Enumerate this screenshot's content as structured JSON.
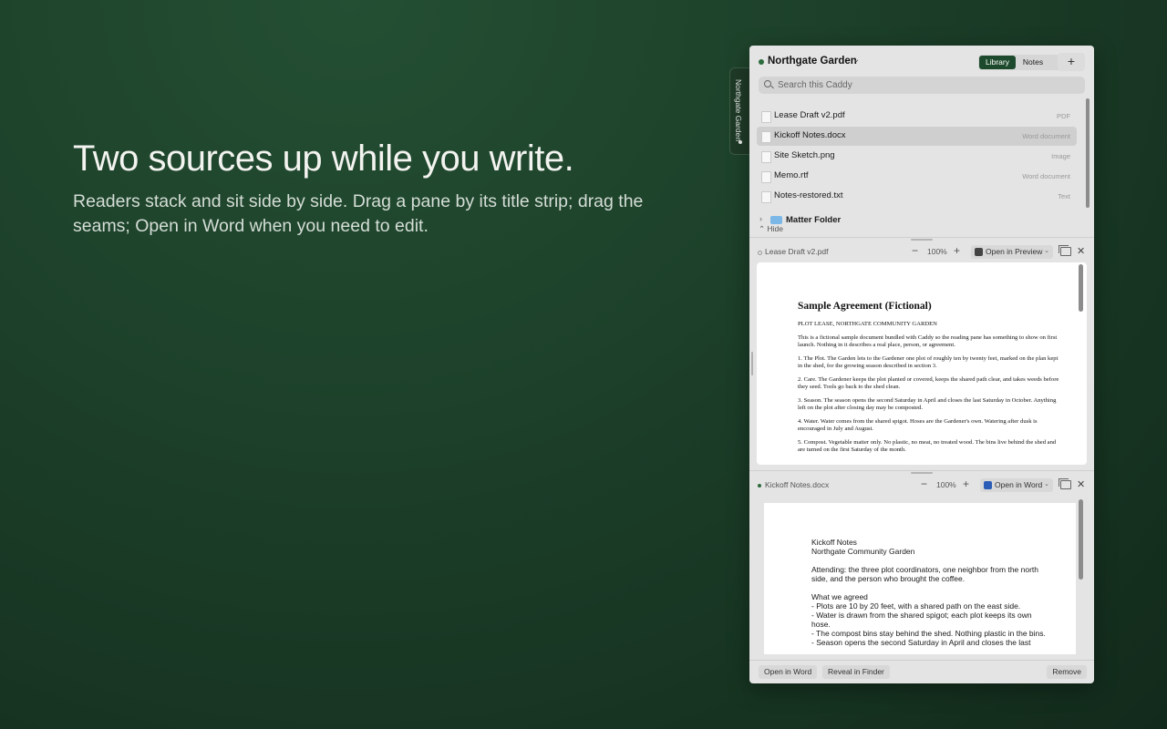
{
  "hero": {
    "headline": "Two sources up while you write.",
    "subline": "Readers stack and sit side by side. Drag a pane by its title strip; drag the seams; Open in Word when you need to edit."
  },
  "side_tab": {
    "label": "Northgate Garden"
  },
  "caddy": {
    "title": "Northgate Garden",
    "segments": {
      "library": "Library",
      "notes": "Notes"
    },
    "add_label": "+",
    "search_placeholder": "Search this Caddy",
    "files": [
      {
        "name": "Lease Draft v2.pdf",
        "type": "PDF"
      },
      {
        "name": "Kickoff Notes.docx",
        "type": "Word document"
      },
      {
        "name": "Site Sketch.png",
        "type": "Image"
      },
      {
        "name": "Memo.rtf",
        "type": "Word document"
      },
      {
        "name": "Notes-restored.txt",
        "type": "Text"
      }
    ],
    "folder": {
      "name": "Matter Folder"
    },
    "hide_label": "Hide"
  },
  "readers": [
    {
      "name": "Lease Draft v2.pdf",
      "zoom": "100%",
      "open_label": "Open in Preview",
      "page_title": "Sample Agreement (Fictional)",
      "lines": [
        "PLOT LEASE, NORTHGATE COMMUNITY GARDEN",
        "This is a fictional sample document bundled with Caddy so the reading pane has something to show on first launch. Nothing in it describes a real place, person, or agreement.",
        "1. The Plot. The Garden lets to the Gardener one plot of roughly ten by twenty feet, marked on the plan kept in the shed, for the growing season described in section 3.",
        "2. Care. The Gardener keeps the plot planted or covered, keeps the shared path clear, and takes weeds before they seed. Tools go back to the shed clean.",
        "3. Season. The season opens the second Saturday in April and closes the last Saturday in October. Anything left on the plot after closing day may be composted.",
        "4. Water. Water comes from the shared spigot. Hoses are the Gardener's own. Watering after dusk is encouraged in July and August.",
        "5. Compost. Vegetable matter only. No plastic, no meat, no treated wood. The bins live behind the shed and are turned on the first Saturday of the month."
      ]
    },
    {
      "name": "Kickoff Notes.docx",
      "zoom": "100%",
      "open_label": "Open in Word",
      "lines": [
        "Kickoff Notes",
        "Northgate Community Garden",
        "",
        "Attending: the three plot coordinators, one neighbor from the north side, and the person who brought the coffee.",
        "",
        "What we agreed",
        "- Plots are 10 by 20 feet, with a shared path on the east side.",
        "- Water is drawn from the shared spigot; each plot keeps its own hose.",
        "- The compost bins stay behind the shed. Nothing plastic in the bins.",
        "- Season opens the second Saturday in April and closes the last"
      ]
    }
  ],
  "footer": {
    "open_word": "Open in Word",
    "reveal": "Reveal in Finder",
    "remove": "Remove"
  },
  "colors": {
    "accent": "#1d4a2c",
    "background": "#1c3f29",
    "panel": "#e4e4e4"
  }
}
